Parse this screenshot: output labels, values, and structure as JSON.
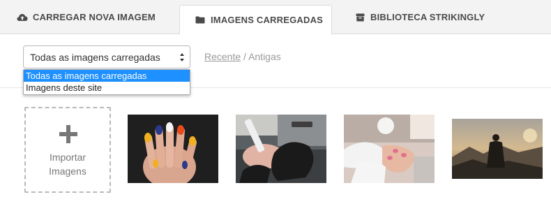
{
  "tabs": [
    {
      "label": "CARREGAR NOVA IMAGEM",
      "icon": "cloud-upload-icon"
    },
    {
      "label": "IMAGENS CARREGADAS",
      "icon": "folder-icon",
      "active": true
    },
    {
      "label": "BIBLIOTECA STRIKINGLY",
      "icon": "archive-box-icon"
    }
  ],
  "filter": {
    "selected": "Todas as imagens carregadas",
    "options": [
      "Todas as imagens carregadas",
      "Imagens deste site"
    ]
  },
  "sort": {
    "recent": "Recente",
    "separator": "/",
    "older": "Antigas"
  },
  "upload": {
    "line1": "Importar",
    "line2": "Imagens"
  },
  "thumbnails": [
    {
      "icon": "painted-nails-photo"
    },
    {
      "icon": "manicure-gloved-hands-photo"
    },
    {
      "icon": "manicure-pink-nails-photo"
    },
    {
      "icon": "mountain-sunset-person-photo"
    }
  ],
  "colors": {
    "selected_option": "#1e90ff",
    "tab_bar": "#f3f3f4"
  }
}
